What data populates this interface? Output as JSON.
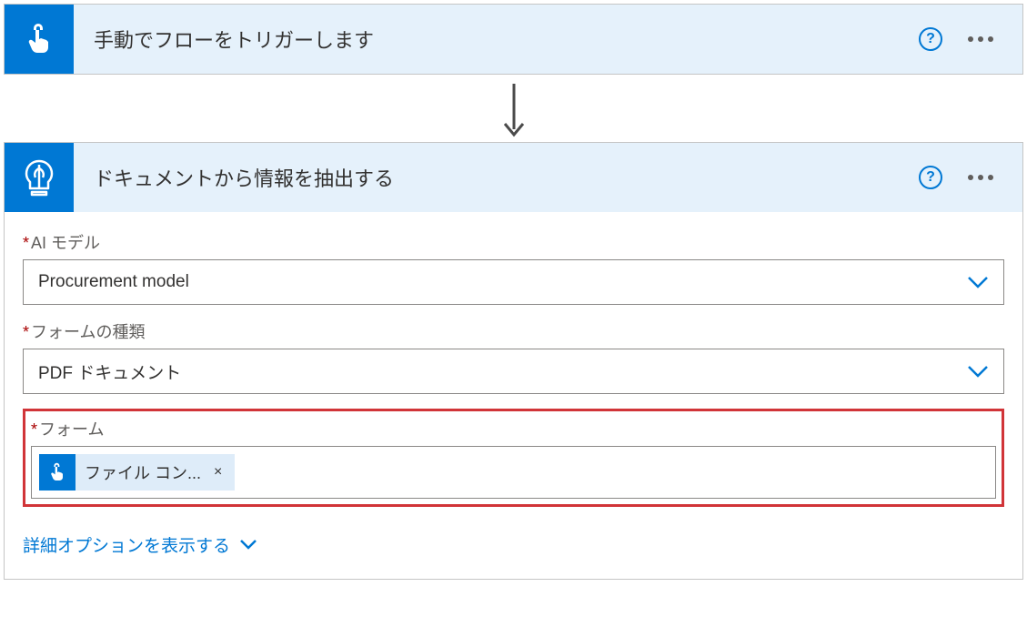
{
  "trigger": {
    "title": "手動でフローをトリガーします"
  },
  "action": {
    "title": "ドキュメントから情報を抽出する",
    "fields": {
      "aiModel": {
        "label": "AI モデル",
        "value": "Procurement model"
      },
      "formType": {
        "label": "フォームの種類",
        "value": "PDF ドキュメント"
      },
      "form": {
        "label": "フォーム",
        "tokenLabel": "ファイル コン...",
        "tokenClose": "×"
      }
    },
    "advancedOptionsLabel": "詳細オプションを表示する"
  },
  "requiredMark": "*"
}
